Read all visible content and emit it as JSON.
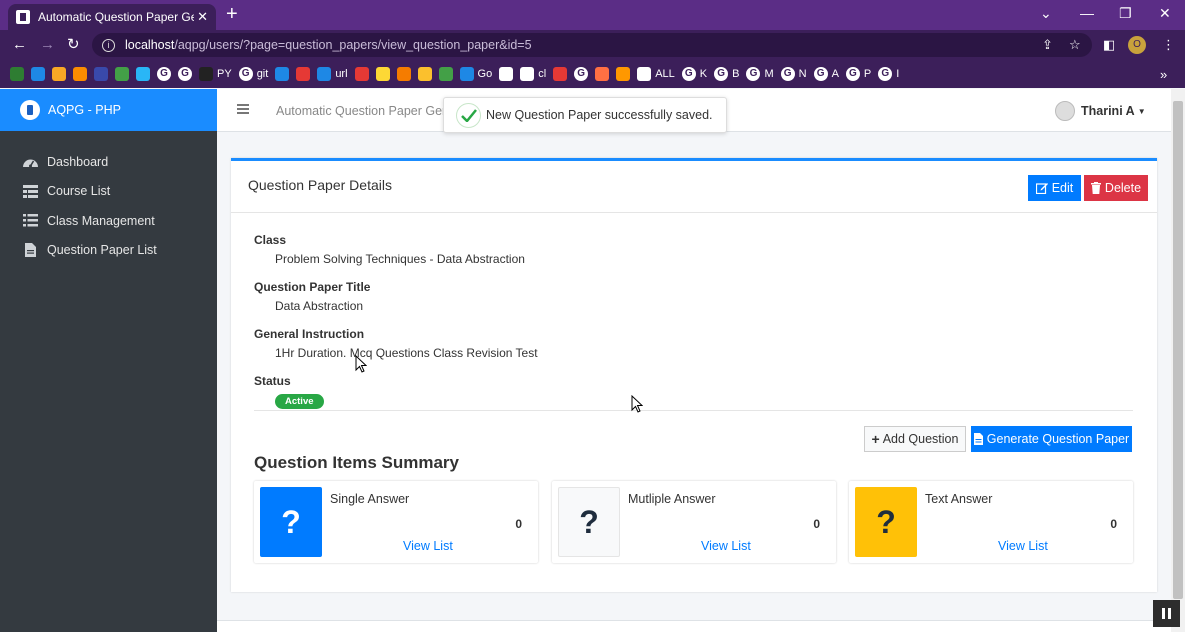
{
  "browser": {
    "tab_title": "Automatic Question Paper Gene",
    "new_tab": "+",
    "url_host": "localhost",
    "url_path": "/aqpg/users/?page=question_papers/view_question_paper&id=5",
    "profile_initial": "O",
    "bookmarks": [
      {
        "label": "",
        "color": "#2e7d32"
      },
      {
        "label": "",
        "color": "#1e88e5"
      },
      {
        "label": "",
        "color": "#f9a825"
      },
      {
        "label": "",
        "color": "#fb8c00"
      },
      {
        "label": "",
        "color": "#3949ab"
      },
      {
        "label": "",
        "color": "#43a047"
      },
      {
        "label": "",
        "color": "#29b6f6"
      },
      {
        "label": "G",
        "color": ""
      },
      {
        "label": "G",
        "color": ""
      },
      {
        "label": "PY",
        "color": "#222"
      },
      {
        "label": "git",
        "color": ""
      },
      {
        "label": "",
        "color": "#1e88e5"
      },
      {
        "label": "",
        "color": "#e53935"
      },
      {
        "label": "url",
        "color": "#1e88e5"
      },
      {
        "label": "",
        "color": "#e53935"
      },
      {
        "label": "",
        "color": "#fdd835"
      },
      {
        "label": "",
        "color": "#f57c00"
      },
      {
        "label": "",
        "color": "#fbc02d"
      },
      {
        "label": "",
        "color": "#43a047"
      },
      {
        "label": "Go",
        "color": "#1e88e5"
      },
      {
        "label": "",
        "color": "#ffffff"
      },
      {
        "label": "cl",
        "color": "#ffffff"
      },
      {
        "label": "",
        "color": "#e53935"
      },
      {
        "label": "G",
        "color": ""
      },
      {
        "label": "",
        "color": "#ff7043"
      },
      {
        "label": "",
        "color": "#ff9800"
      },
      {
        "label": "ALL",
        "color": "#ffffff"
      },
      {
        "label": "K",
        "color": ""
      },
      {
        "label": "B",
        "color": ""
      },
      {
        "label": "M",
        "color": ""
      },
      {
        "label": "N",
        "color": ""
      },
      {
        "label": "A",
        "color": ""
      },
      {
        "label": "P",
        "color": ""
      },
      {
        "label": "I",
        "color": ""
      }
    ],
    "more": "»"
  },
  "sidebar": {
    "brand": "AQPG - PHP",
    "items": [
      {
        "label": "Dashboard",
        "icon": "tachometer-icon"
      },
      {
        "label": "Course List",
        "icon": "table-icon"
      },
      {
        "label": "Class Management",
        "icon": "list-icon"
      },
      {
        "label": "Question Paper List",
        "icon": "file-icon"
      }
    ]
  },
  "topnav": {
    "title": "Automatic Question Paper Gen",
    "user": "Tharini A"
  },
  "toast": {
    "message": "New Question Paper successfully saved."
  },
  "card": {
    "title": "Question Paper Details",
    "edit_label": "Edit",
    "delete_label": "Delete",
    "fields": {
      "class_label": "Class",
      "class_value": "Problem Solving Techniques - Data Abstraction",
      "title_label": "Question Paper Title",
      "title_value": "Data Abstraction",
      "instruction_label": "General Instruction",
      "instruction_value": "1Hr Duration. Mcq Questions Class Revision Test",
      "status_label": "Status",
      "status_value": "Active"
    },
    "add_question_label": "Add Question",
    "generate_label": "Generate Question Paper",
    "summary_title": "Question Items Summary",
    "summary": [
      {
        "label": "Single Answer",
        "count": "0",
        "link": "View List",
        "icon": "?",
        "bg": "#007bff",
        "fg": "#ffffff"
      },
      {
        "label": "Mutliple Answer",
        "count": "0",
        "link": "View List",
        "icon": "?",
        "bg": "#f8f9fa",
        "fg": "#1f2d3d"
      },
      {
        "label": "Text Answer",
        "count": "0",
        "link": "View List",
        "icon": "?",
        "bg": "#ffc107",
        "fg": "#1f2d3d"
      }
    ]
  }
}
